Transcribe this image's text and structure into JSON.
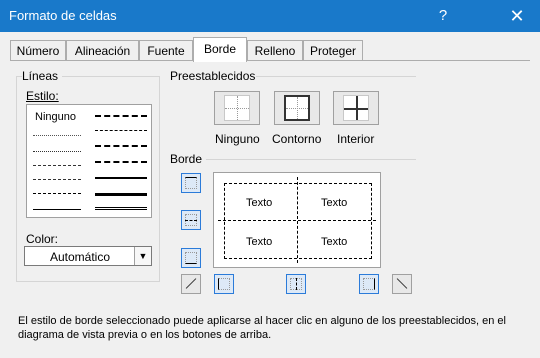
{
  "window": {
    "title": "Formato de celdas",
    "help_label": "?",
    "close_label": "✕"
  },
  "tabs": [
    {
      "label": "Número"
    },
    {
      "label": "Alineación"
    },
    {
      "label": "Fuente"
    },
    {
      "label": "Borde",
      "active": true
    },
    {
      "label": "Relleno"
    },
    {
      "label": "Proteger"
    }
  ],
  "lineas": {
    "group_label": "Líneas",
    "style_label": "Estilo:",
    "none_label": "Ninguno",
    "color_label": "Color:",
    "color_value": "Automático"
  },
  "presets": {
    "group_label": "Preestablecidos",
    "items": [
      {
        "label": "Ninguno"
      },
      {
        "label": "Contorno"
      },
      {
        "label": "Interior"
      }
    ]
  },
  "border": {
    "group_label": "Borde",
    "preview_texts": [
      "Texto",
      "Texto",
      "Texto",
      "Texto"
    ]
  },
  "info_text": "El estilo de borde seleccionado puede aplicarse al hacer clic en alguno de los preestablecidos, en el diagrama de vista previa o en los botones de arriba.",
  "colors": {
    "titlebar": "#1979ca",
    "selected_border": "#2b7bd9"
  }
}
